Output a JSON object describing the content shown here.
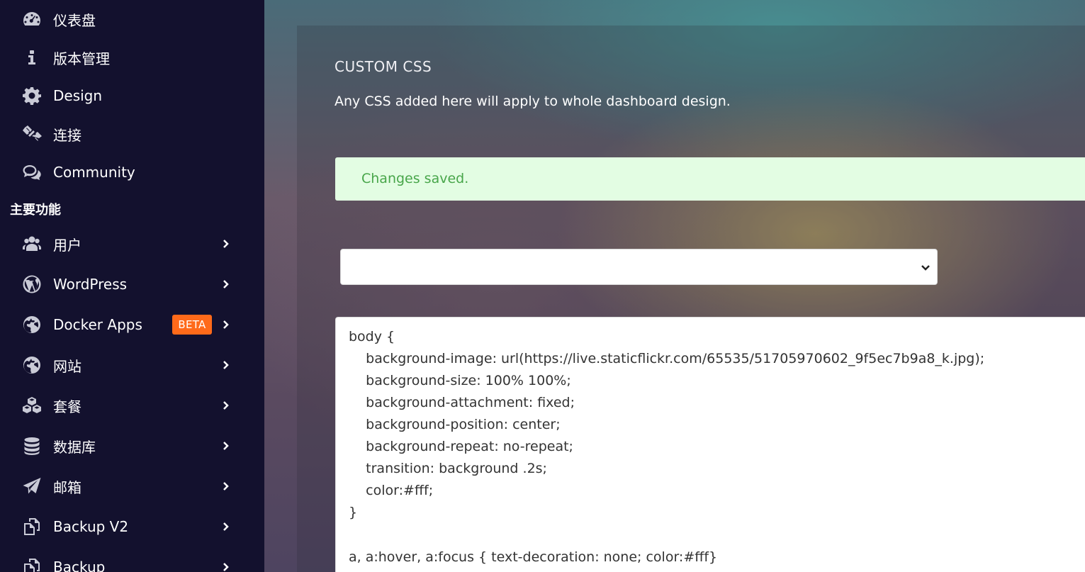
{
  "sidebar": {
    "items_top": [
      {
        "label": "仪表盘",
        "icon": "dashboard-icon"
      },
      {
        "label": "版本管理",
        "icon": "info-icon"
      },
      {
        "label": "Design",
        "icon": "gear-icon"
      },
      {
        "label": "连接",
        "icon": "link-icon"
      },
      {
        "label": "Community",
        "icon": "comments-icon"
      }
    ],
    "section_title": "主要功能",
    "items_main": [
      {
        "label": "用户",
        "icon": "users-icon"
      },
      {
        "label": "WordPress",
        "icon": "wordpress-icon"
      },
      {
        "label": "Docker Apps",
        "icon": "globe-icon",
        "badge": "BETA"
      },
      {
        "label": "网站",
        "icon": "globe-icon"
      },
      {
        "label": "套餐",
        "icon": "cubes-icon"
      },
      {
        "label": "数据库",
        "icon": "database-icon"
      },
      {
        "label": "邮箱",
        "icon": "paper-plane-icon"
      },
      {
        "label": "Backup V2",
        "icon": "copy-icon"
      },
      {
        "label": "Backup",
        "icon": "copy-icon"
      }
    ]
  },
  "main": {
    "title": "CUSTOM CSS",
    "description": "Any CSS added here will apply to whole dashboard design.",
    "alert": "Changes saved.",
    "select": {
      "value": ""
    },
    "editor_lines": [
      "body {",
      "    background-image: url(https://live.staticflickr.com/65535/51705970602_9f5ec7b9a8_k.jpg);",
      "    background-size: 100% 100%;",
      "    background-attachment: fixed;",
      "    background-position: center;",
      "    background-repeat: no-repeat;",
      "    transition: background .2s;",
      "    color:#fff;",
      "}",
      "",
      "a, a:hover, a:focus { text-decoration: none; color:#fff}"
    ]
  },
  "colors": {
    "sidebar_bg": "#13112e",
    "badge_bg": "#ff6a1a",
    "alert_bg": "#e3fde3",
    "alert_text": "#48a64a"
  }
}
